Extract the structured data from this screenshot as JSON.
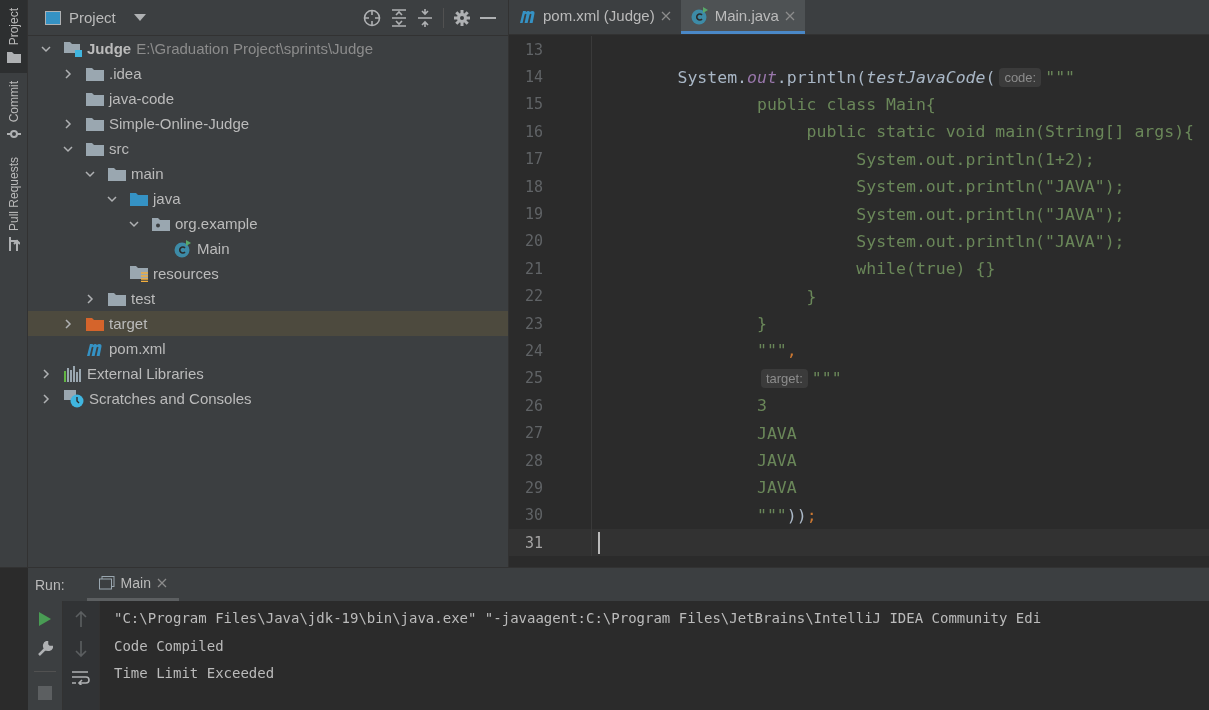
{
  "activity_bar": [
    {
      "label": "Project",
      "selected": true,
      "kind": "project"
    },
    {
      "label": "Commit",
      "selected": false,
      "kind": "commit"
    },
    {
      "label": "Pull Requests",
      "selected": false,
      "kind": "pull"
    }
  ],
  "project_panel": {
    "title": "Project",
    "tree": [
      {
        "name": "Judge",
        "path": "E:\\Graduation Project\\sprints\\Judge",
        "kind": "module",
        "expanded": true,
        "selected": false,
        "children": [
          {
            "name": ".idea",
            "kind": "folder",
            "expanded": false,
            "selected": false
          },
          {
            "name": "java-code",
            "kind": "folder",
            "selected": false
          },
          {
            "name": "Simple-Online-Judge",
            "kind": "folder",
            "expanded": false,
            "selected": false
          },
          {
            "name": "src",
            "kind": "folder",
            "expanded": true,
            "selected": false,
            "children": [
              {
                "name": "main",
                "kind": "folder",
                "expanded": true,
                "selected": false,
                "children": [
                  {
                    "name": "java",
                    "kind": "source",
                    "expanded": true,
                    "selected": false,
                    "children": [
                      {
                        "name": "org.example",
                        "kind": "package",
                        "expanded": true,
                        "selected": false,
                        "children": [
                          {
                            "name": "Main",
                            "kind": "class",
                            "selected": false
                          }
                        ]
                      }
                    ]
                  },
                  {
                    "name": "resources",
                    "kind": "resources",
                    "selected": false
                  }
                ]
              },
              {
                "name": "test",
                "kind": "folder",
                "expanded": false,
                "selected": false
              }
            ]
          },
          {
            "name": "target",
            "kind": "excluded",
            "expanded": false,
            "selected": true
          },
          {
            "name": "pom.xml",
            "kind": "maven",
            "selected": false
          }
        ]
      },
      {
        "name": "External Libraries",
        "kind": "libraries",
        "expanded": false,
        "selected": false
      },
      {
        "name": "Scratches and Consoles",
        "kind": "scratches",
        "expanded": false,
        "selected": false
      }
    ]
  },
  "editor_tabs": [
    {
      "label": "pom.xml (Judge)",
      "kind": "maven",
      "selected": false,
      "closable": true
    },
    {
      "label": "Main.java",
      "kind": "class",
      "selected": true,
      "closable": true
    }
  ],
  "code_lines": [
    {
      "number": "13",
      "current": false
    },
    {
      "number": "14",
      "current": false,
      "segments": [
        {
          "kind": "plain",
          "text": "        System."
        },
        {
          "kind": "field",
          "text": "out"
        },
        {
          "kind": "plain",
          "text": ".println("
        },
        {
          "kind": "call",
          "text": "testJavaCode"
        },
        {
          "kind": "plain",
          "text": "("
        },
        {
          "kind": "hint",
          "text": "code:"
        },
        {
          "kind": "string",
          "text": "\"\"\""
        }
      ]
    },
    {
      "number": "15",
      "current": false,
      "segments": [
        {
          "kind": "string",
          "text": "                public class Main{"
        }
      ]
    },
    {
      "number": "16",
      "current": false,
      "segments": [
        {
          "kind": "string",
          "text": "                     public static void main(String[] args){"
        }
      ]
    },
    {
      "number": "17",
      "current": false,
      "segments": [
        {
          "kind": "string",
          "text": "                          System.out.println(1+2);"
        }
      ]
    },
    {
      "number": "18",
      "current": false,
      "segments": [
        {
          "kind": "string",
          "text": "                          System.out.println(\"JAVA\");"
        }
      ]
    },
    {
      "number": "19",
      "current": false,
      "segments": [
        {
          "kind": "string",
          "text": "                          System.out.println(\"JAVA\");"
        }
      ]
    },
    {
      "number": "20",
      "current": false,
      "segments": [
        {
          "kind": "string",
          "text": "                          System.out.println(\"JAVA\");"
        }
      ]
    },
    {
      "number": "21",
      "current": false,
      "segments": [
        {
          "kind": "string",
          "text": "                          while(true) {}"
        }
      ]
    },
    {
      "number": "22",
      "current": false,
      "segments": [
        {
          "kind": "string",
          "text": "                     }"
        }
      ]
    },
    {
      "number": "23",
      "current": false,
      "segments": [
        {
          "kind": "string",
          "text": "                }"
        }
      ]
    },
    {
      "number": "24",
      "current": false,
      "segments": [
        {
          "kind": "string",
          "text": "                \"\"\""
        },
        {
          "kind": "keyword",
          "text": ","
        }
      ]
    },
    {
      "number": "25",
      "current": false,
      "segments": [
        {
          "kind": "hint",
          "text": "target:"
        },
        {
          "kind": "string",
          "text": "\"\"\""
        }
      ]
    },
    {
      "number": "26",
      "current": false,
      "segments": [
        {
          "kind": "string",
          "text": "                3"
        }
      ]
    },
    {
      "number": "27",
      "current": false,
      "segments": [
        {
          "kind": "string",
          "text": "                JAVA"
        }
      ]
    },
    {
      "number": "28",
      "current": false,
      "segments": [
        {
          "kind": "string",
          "text": "                JAVA"
        }
      ]
    },
    {
      "number": "29",
      "current": false,
      "segments": [
        {
          "kind": "string",
          "text": "                JAVA"
        }
      ]
    },
    {
      "number": "30",
      "current": false,
      "segments": [
        {
          "kind": "string",
          "text": "                \"\"\""
        },
        {
          "kind": "plain",
          "text": "))"
        },
        {
          "kind": "keyword",
          "text": ";"
        }
      ]
    },
    {
      "number": "31",
      "current": true
    }
  ],
  "run_panel": {
    "label": "Run:",
    "tab": {
      "label": "Main",
      "selected": true
    },
    "output": [
      "\"C:\\Program Files\\Java\\jdk-19\\bin\\java.exe\" \"-javaagent:C:\\Program Files\\JetBrains\\IntelliJ IDEA Community Edi",
      "Code Compiled",
      "Time Limit Exceeded"
    ]
  }
}
